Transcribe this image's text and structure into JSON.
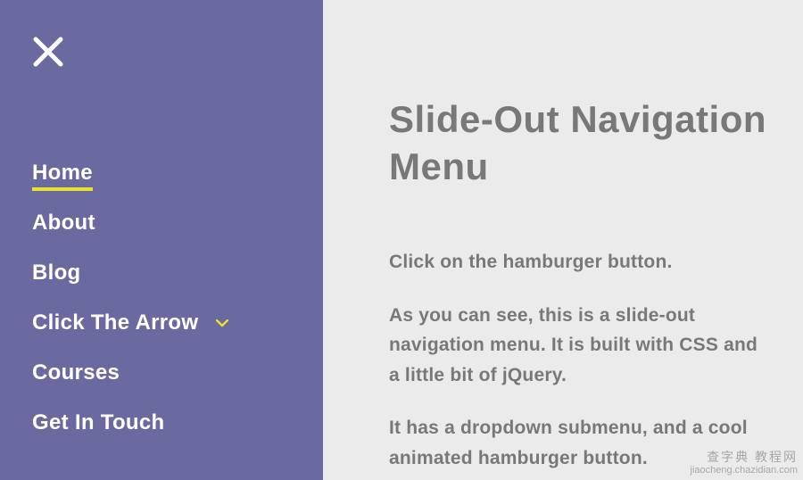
{
  "sidebar": {
    "nav": [
      {
        "label": "Home",
        "active": true,
        "hasDropdown": false
      },
      {
        "label": "About",
        "active": false,
        "hasDropdown": false
      },
      {
        "label": "Blog",
        "active": false,
        "hasDropdown": false
      },
      {
        "label": "Click The Arrow",
        "active": false,
        "hasDropdown": true
      },
      {
        "label": "Courses",
        "active": false,
        "hasDropdown": false
      },
      {
        "label": "Get In Touch",
        "active": false,
        "hasDropdown": false
      }
    ]
  },
  "main": {
    "title": "Slide-Out Navigation Menu",
    "paragraphs": [
      "Click on the hamburger button.",
      "As you can see, this is a slide-out navigation menu. It is built with CSS and a little bit of jQuery.",
      "It has a dropdown submenu, and a cool animated hamburger button."
    ]
  },
  "watermark": {
    "line1": "查字典 教程网",
    "line2": "jiaocheng.chazidian.com"
  },
  "colors": {
    "sidebarBg": "#6a69a0",
    "mainBg": "#ebebeb",
    "accent": "#e6e22e",
    "text": "#787878"
  }
}
